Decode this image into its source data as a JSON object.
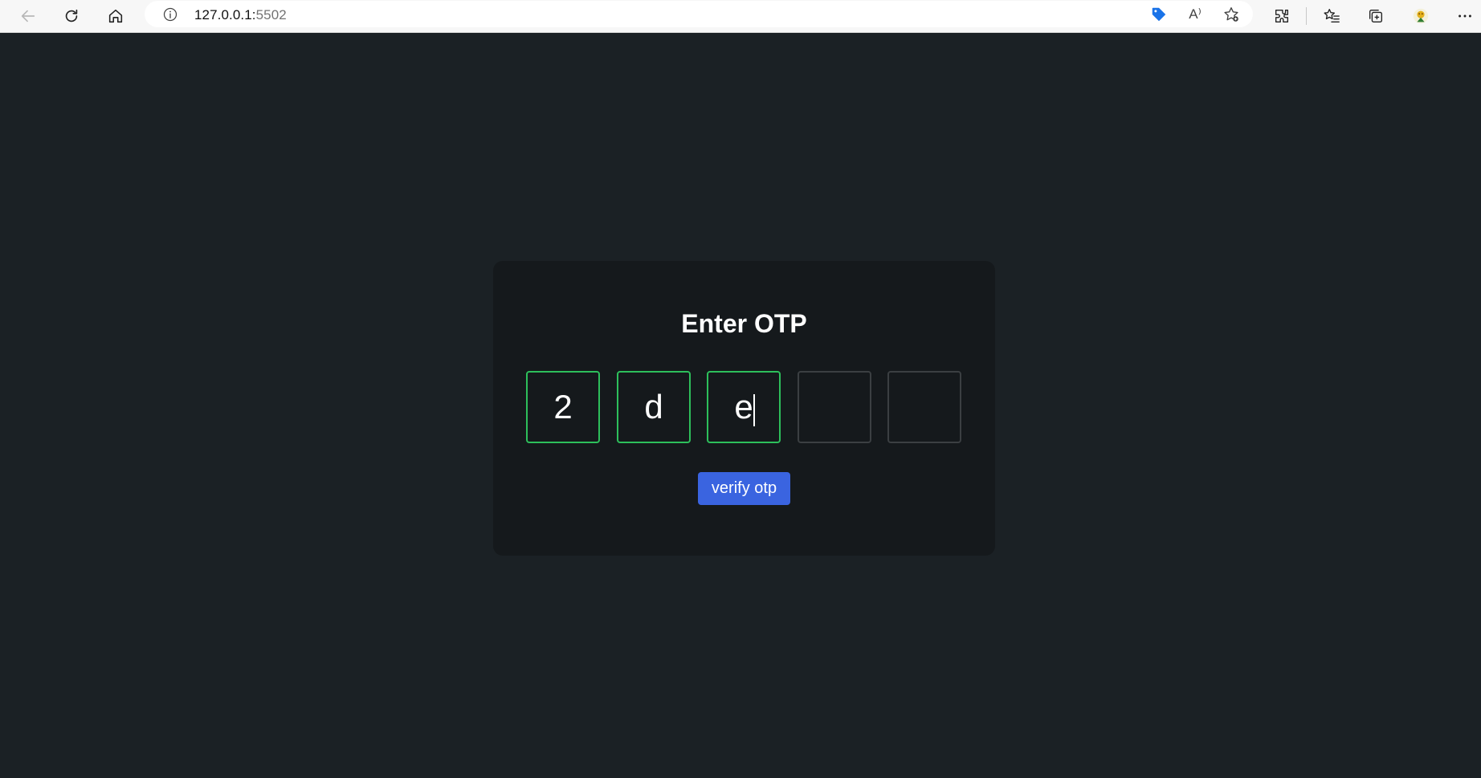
{
  "browser": {
    "url_host": "127.0.0.1:",
    "url_port": "5502",
    "nav": [
      "back-icon",
      "refresh-icon",
      "home-icon"
    ],
    "address_icons": [
      "site-info-icon",
      "shopping-tag-icon",
      "read-aloud-icon",
      "add-favorite-icon"
    ],
    "right_icons": [
      "extensions-icon",
      "favorites-icon",
      "collections-icon",
      "profile-avatar",
      "more-icon"
    ],
    "read_aloud_glyph": "A⁾"
  },
  "page": {
    "background": "#1b2125",
    "card": {
      "title": "Enter OTP",
      "otp": [
        {
          "value": "2",
          "state": "filled"
        },
        {
          "value": "d",
          "state": "filled"
        },
        {
          "value": "e",
          "state": "filled-focused"
        },
        {
          "value": "",
          "state": "empty"
        },
        {
          "value": "",
          "state": "empty"
        }
      ],
      "button_label": "verify otp",
      "accent_green": "#2dbf5b",
      "button_color": "#3a64e0"
    }
  }
}
